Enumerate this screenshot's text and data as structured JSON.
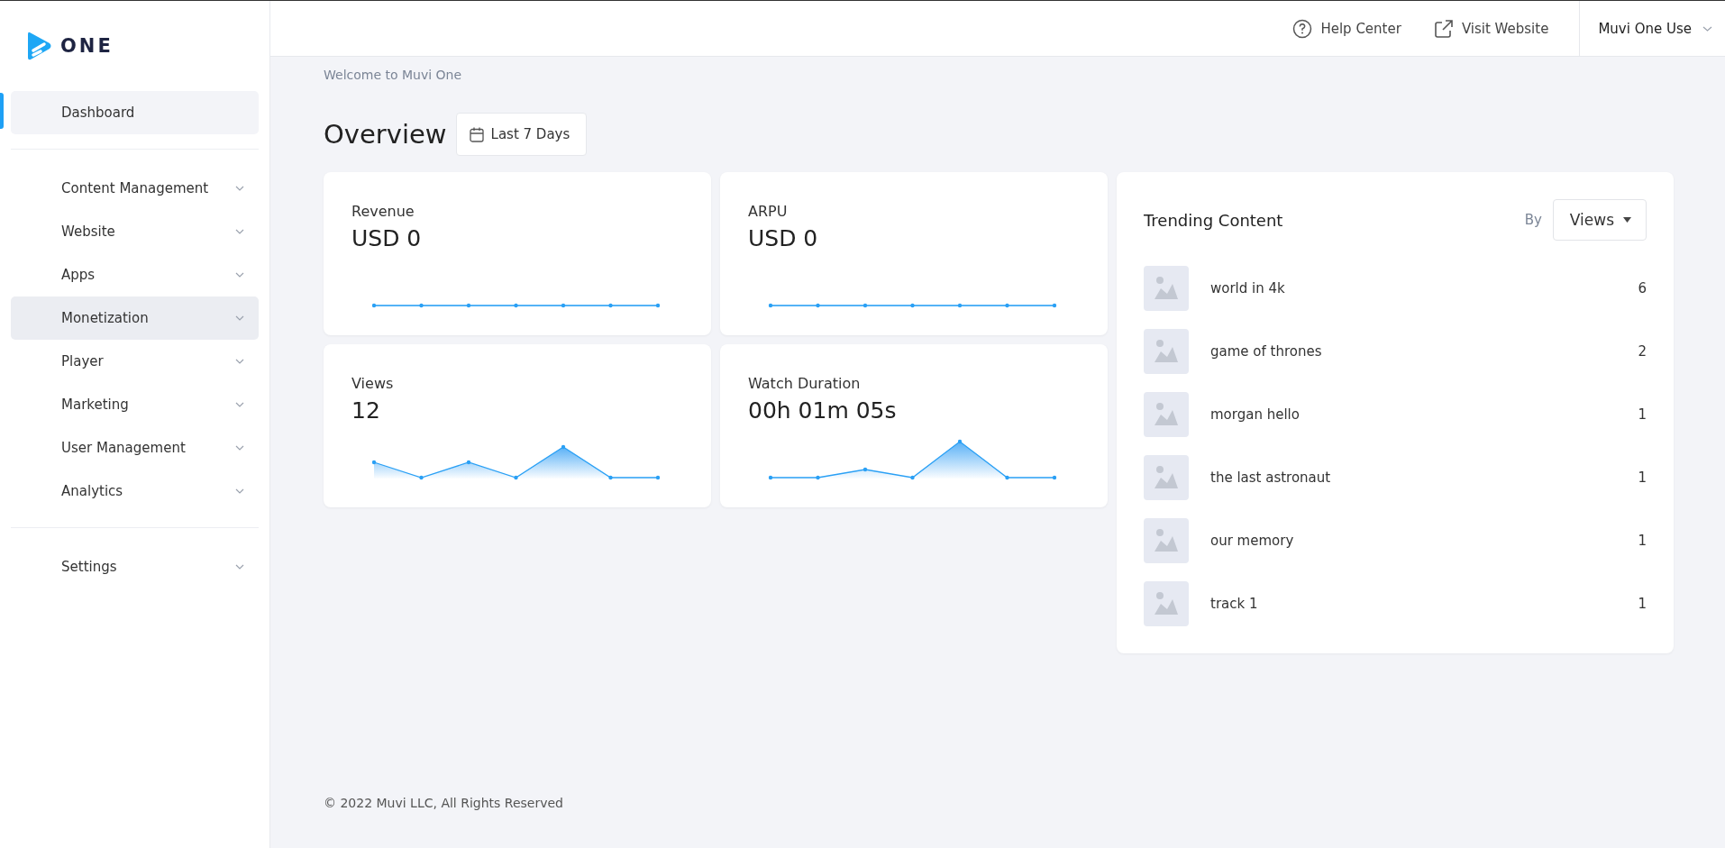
{
  "sidebar": {
    "logo_text": "ONE",
    "sections": [
      {
        "items": [
          {
            "label": "Dashboard",
            "selected": true,
            "hovered": false,
            "expandable": false
          }
        ]
      },
      {
        "items": [
          {
            "label": "Content Management",
            "selected": false,
            "hovered": false,
            "expandable": true
          },
          {
            "label": "Website",
            "selected": false,
            "hovered": false,
            "expandable": true
          },
          {
            "label": "Apps",
            "selected": false,
            "hovered": false,
            "expandable": true
          },
          {
            "label": "Monetization",
            "selected": false,
            "hovered": true,
            "expandable": true
          },
          {
            "label": "Player",
            "selected": false,
            "hovered": false,
            "expandable": true
          },
          {
            "label": "Marketing",
            "selected": false,
            "hovered": false,
            "expandable": true
          },
          {
            "label": "User Management",
            "selected": false,
            "hovered": false,
            "expandable": true
          },
          {
            "label": "Analytics",
            "selected": false,
            "hovered": false,
            "expandable": true
          }
        ]
      },
      {
        "items": [
          {
            "label": "Settings",
            "selected": false,
            "hovered": false,
            "expandable": true
          }
        ]
      }
    ]
  },
  "header": {
    "help": "Help Center",
    "visit": "Visit Website",
    "user": "Muvi One Use"
  },
  "welcome": "Welcome to Muvi One",
  "overview": {
    "title": "Overview",
    "range": "Last 7 Days"
  },
  "cards": [
    {
      "label": "Revenue",
      "value": "USD 0"
    },
    {
      "label": "ARPU",
      "value": "USD 0"
    },
    {
      "label": "Views",
      "value": "12"
    },
    {
      "label": "Watch Duration",
      "value": "00h 01m 05s"
    }
  ],
  "trending": {
    "title": "Trending Content",
    "by": "By",
    "sort": "Views",
    "items": [
      {
        "title": "world in 4k",
        "count": "6"
      },
      {
        "title": "game of thrones",
        "count": "2"
      },
      {
        "title": "morgan hello",
        "count": "1"
      },
      {
        "title": "the last astronaut",
        "count": "1"
      },
      {
        "title": "our memory",
        "count": "1"
      },
      {
        "title": "track 1",
        "count": "1"
      }
    ]
  },
  "footer": "© 2022 Muvi LLC, All Rights Reserved"
}
